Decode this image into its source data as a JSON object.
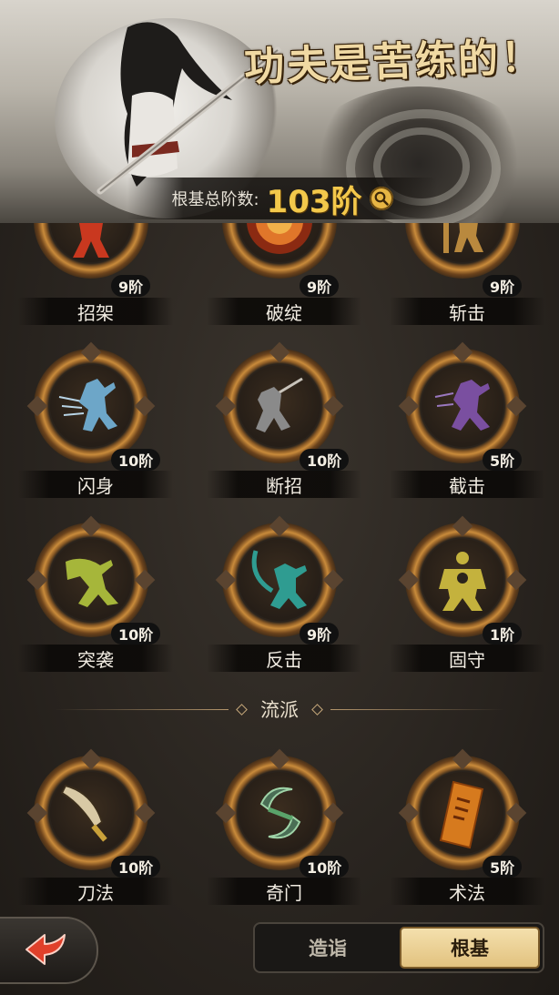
{
  "banner": {
    "slogan": "功夫是苦练的！",
    "total_label": "根基总阶数:",
    "total_value": "103阶",
    "search_icon": "magnifier-icon"
  },
  "skills_row1": [
    {
      "name": "招架",
      "level": "9阶",
      "color": "#c9381f",
      "icon": "parry-figure-icon"
    },
    {
      "name": "破绽",
      "level": "9阶",
      "color": "#e0762a",
      "icon": "target-icon"
    },
    {
      "name": "斩击",
      "level": "9阶",
      "color": "#b9893e",
      "icon": "slash-figure-icon"
    }
  ],
  "skills_row2": [
    {
      "name": "闪身",
      "level": "10阶",
      "color": "#6da6c8",
      "icon": "dodge-figure-icon"
    },
    {
      "name": "断招",
      "level": "10阶",
      "color": "#8a8a8a",
      "icon": "sword-figure-icon"
    },
    {
      "name": "截击",
      "level": "5阶",
      "color": "#7a4fa0",
      "icon": "intercept-figure-icon"
    }
  ],
  "skills_row3": [
    {
      "name": "突袭",
      "level": "10阶",
      "color": "#a6b63a",
      "icon": "raid-figure-icon"
    },
    {
      "name": "反击",
      "level": "9阶",
      "color": "#2f9c91",
      "icon": "counter-figure-icon"
    },
    {
      "name": "固守",
      "level": "1阶",
      "color": "#c4b23d",
      "icon": "guard-figure-icon"
    }
  ],
  "section_title": "流派",
  "schools": [
    {
      "name": "刀法",
      "level": "10阶",
      "color": "#d8c9a5",
      "icon": "broadsword-icon"
    },
    {
      "name": "奇门",
      "level": "10阶",
      "color": "#5aa36a",
      "icon": "hook-blades-icon"
    },
    {
      "name": "术法",
      "level": "5阶",
      "color": "#d67a1e",
      "icon": "talisman-scroll-icon"
    }
  ],
  "tabs": {
    "left": "造诣",
    "right": "根基",
    "active": "right"
  }
}
